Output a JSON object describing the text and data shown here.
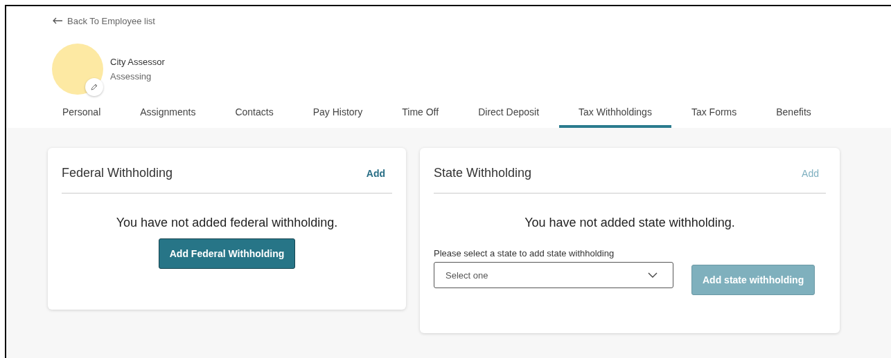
{
  "back_link": {
    "label": "Back To Employee list"
  },
  "profile": {
    "title": "City Assessor",
    "department": "Assessing"
  },
  "tabs": [
    {
      "label": "Personal",
      "selected": false
    },
    {
      "label": "Assignments",
      "selected": false
    },
    {
      "label": "Contacts",
      "selected": false
    },
    {
      "label": "Pay History",
      "selected": false
    },
    {
      "label": "Time Off",
      "selected": false
    },
    {
      "label": "Direct Deposit",
      "selected": false
    },
    {
      "label": "Tax Withholdings",
      "selected": true
    },
    {
      "label": "Tax Forms",
      "selected": false
    },
    {
      "label": "Benefits",
      "selected": false
    }
  ],
  "cards": [
    {
      "kind": "federal",
      "title": "Federal Withholding",
      "add_link": {
        "label": "Add",
        "disabled": false
      },
      "message": "You have not added federal withholding.",
      "button": {
        "label": "Add Federal Withholding",
        "disabled": false
      }
    },
    {
      "kind": "state",
      "title": "State Withholding",
      "add_link": {
        "label": "Add",
        "disabled": true
      },
      "message": "You have not added state withholding.",
      "select_label": "Please select a state to add state withholding",
      "select": {
        "placeholder": "Select one"
      },
      "button": {
        "label": "Add state withholding",
        "disabled": true
      }
    }
  ]
}
